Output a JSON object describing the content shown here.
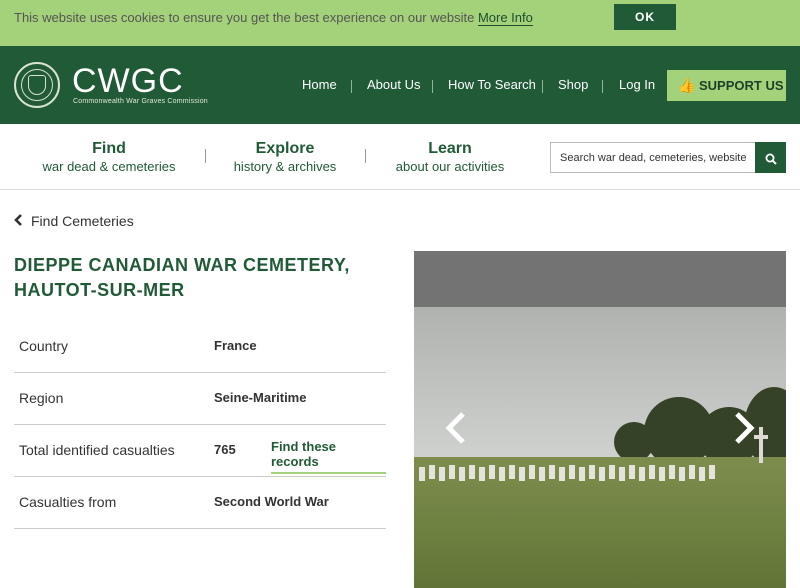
{
  "cookie": {
    "text": "This website uses cookies to ensure you get the best experience on our website",
    "link": "More Info",
    "ok": "OK"
  },
  "header": {
    "logo": "CWGC",
    "logo_sub": "Commonwealth War Graves Commission",
    "nav": [
      "Home",
      "About Us",
      "How To Search",
      "Shop",
      "Log In"
    ],
    "support": "SUPPORT US"
  },
  "subnav": {
    "items": [
      {
        "t1": "Find",
        "t2": "war dead & cemeteries"
      },
      {
        "t1": "Explore",
        "t2": "history & archives"
      },
      {
        "t1": "Learn",
        "t2": "about our activities"
      }
    ],
    "search_value": "Search war dead, cemeteries, website"
  },
  "page": {
    "back": "Find Cemeteries",
    "title": "DIEPPE CANADIAN WAR CEMETERY, HAUTOT-SUR-MER",
    "details": [
      {
        "label": "Country",
        "value": "France"
      },
      {
        "label": "Region",
        "value": "Seine-Maritime"
      },
      {
        "label": "Total identified casualties",
        "value": "765",
        "link": "Find these records"
      },
      {
        "label": "Casualties from",
        "value": "Second World War"
      }
    ]
  },
  "colors": {
    "brand_green": "#215a36",
    "light_green": "#a3d27a"
  }
}
